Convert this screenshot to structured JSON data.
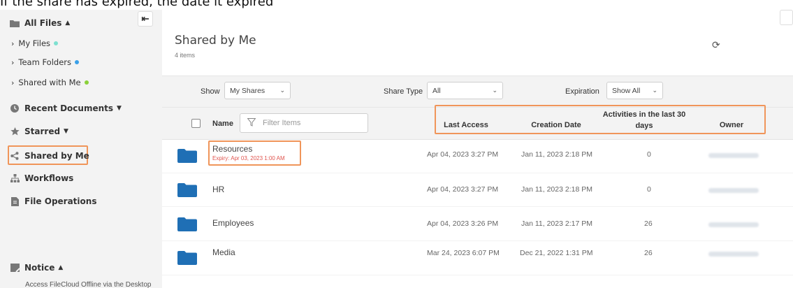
{
  "caption": "If the share has expired, the date it expired",
  "colors": {
    "accent_blue": "#1f6fb5",
    "expiry_red": "#e0554f",
    "highlight_orange": "#f0955a",
    "dot_myfiles": "#7ee0d0",
    "dot_teamfolders": "#3aa0e8",
    "dot_sharedwithme": "#8bd13a"
  },
  "sidebar": {
    "collapse_icon": "collapse-left-icon",
    "all_files": {
      "label": "All Files",
      "icon": "folder-icon"
    },
    "sub_items": [
      {
        "label": "My Files"
      },
      {
        "label": "Team Folders"
      },
      {
        "label": "Shared with Me"
      }
    ],
    "recent": {
      "label": "Recent Documents",
      "icon": "clock-icon"
    },
    "starred": {
      "label": "Starred",
      "icon": "star-icon"
    },
    "shared_by_me": {
      "label": "Shared by Me",
      "icon": "share-icon"
    },
    "workflows": {
      "label": "Workflows",
      "icon": "workflow-icon"
    },
    "file_operations": {
      "label": "File Operations",
      "icon": "file-operations-icon"
    },
    "notice": {
      "label": "Notice",
      "icon": "notice-icon",
      "text": "Access FileCloud Offline via the Desktop"
    }
  },
  "header": {
    "title": "Shared by Me",
    "subtitle": "4 items",
    "refresh_icon": "refresh-icon"
  },
  "filters": {
    "show_label": "Show",
    "show_value": "My Shares",
    "share_type_label": "Share Type",
    "share_type_value": "All",
    "expiration_label": "Expiration",
    "expiration_value": "Show All"
  },
  "table": {
    "name_header": "Name",
    "filter_placeholder": "Filter Items",
    "columns": {
      "last_access": "Last Access",
      "creation_date": "Creation Date",
      "activities": "Activities in the last 30 days",
      "owner": "Owner"
    },
    "rows": [
      {
        "name": "Resources",
        "expiry": "Expiry: Apr 03, 2023 1:00 AM",
        "last_access": "Apr 04, 2023 3:27 PM",
        "created": "Jan 11, 2023 2:18 PM",
        "activities": "0"
      },
      {
        "name": "HR",
        "expiry": "",
        "last_access": "Apr 04, 2023 3:27 PM",
        "created": "Jan 11, 2023 2:18 PM",
        "activities": "0"
      },
      {
        "name": "Employees",
        "expiry": "",
        "last_access": "Apr 04, 2023 3:26 PM",
        "created": "Jan 11, 2023 2:17 PM",
        "activities": "26"
      },
      {
        "name": "Media",
        "expiry": "",
        "last_access": "Mar 24, 2023 6:07 PM",
        "created": "Dec 21, 2022 1:31 PM",
        "activities": "26"
      }
    ]
  }
}
